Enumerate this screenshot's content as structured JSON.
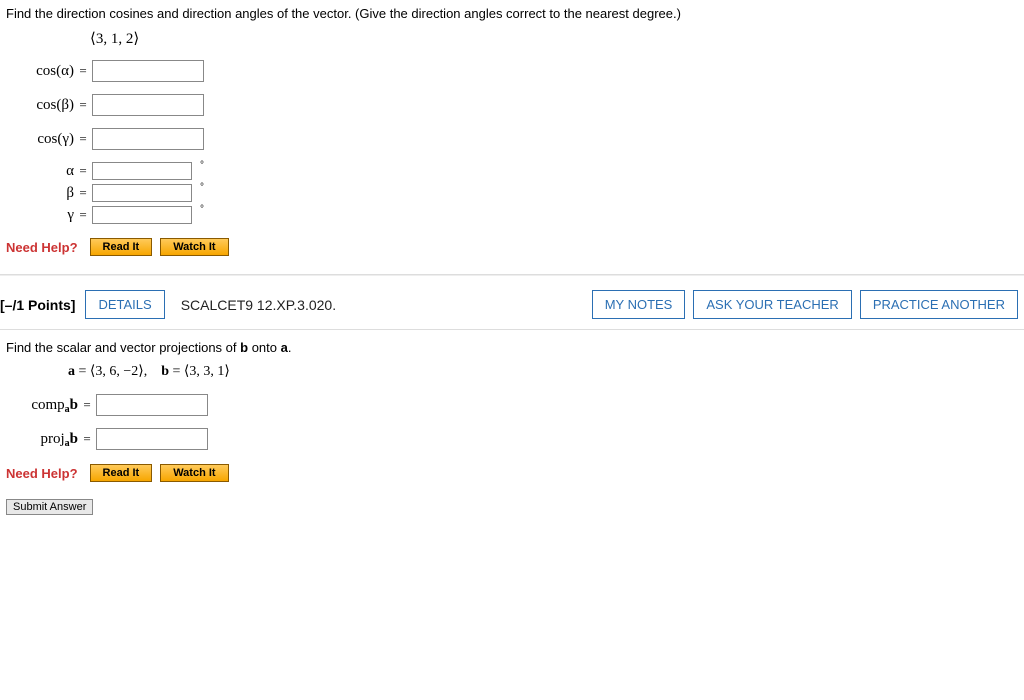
{
  "q1": {
    "prompt": "Find the direction cosines and direction angles of the vector. (Give the direction angles correct to the nearest degree.)",
    "vector": "⟨3, 1, 2⟩",
    "labels": {
      "cos_alpha": "cos(α)",
      "cos_beta": "cos(β)",
      "cos_gamma": "cos(γ)",
      "alpha": "α",
      "beta": "β",
      "gamma": "γ"
    },
    "eq": "=",
    "deg_symbol": "°"
  },
  "help": {
    "need_help": "Need Help?",
    "read_it": "Read It",
    "watch_it": "Watch It"
  },
  "q2header": {
    "points": "[–/1 Points]",
    "details": "DETAILS",
    "ref": "SCALCET9 12.XP.3.020.",
    "my_notes": "MY NOTES",
    "ask_teacher": "ASK YOUR TEACHER",
    "practice": "PRACTICE ANOTHER"
  },
  "q2": {
    "prompt": "Find the scalar and vector projections of b onto a.",
    "vectors_html": "a = ⟨3, 6, −2⟩, b = ⟨3, 3, 1⟩",
    "comp_label": "compab",
    "proj_label": "projab",
    "eq": "="
  },
  "submit": {
    "label": "Submit Answer"
  }
}
